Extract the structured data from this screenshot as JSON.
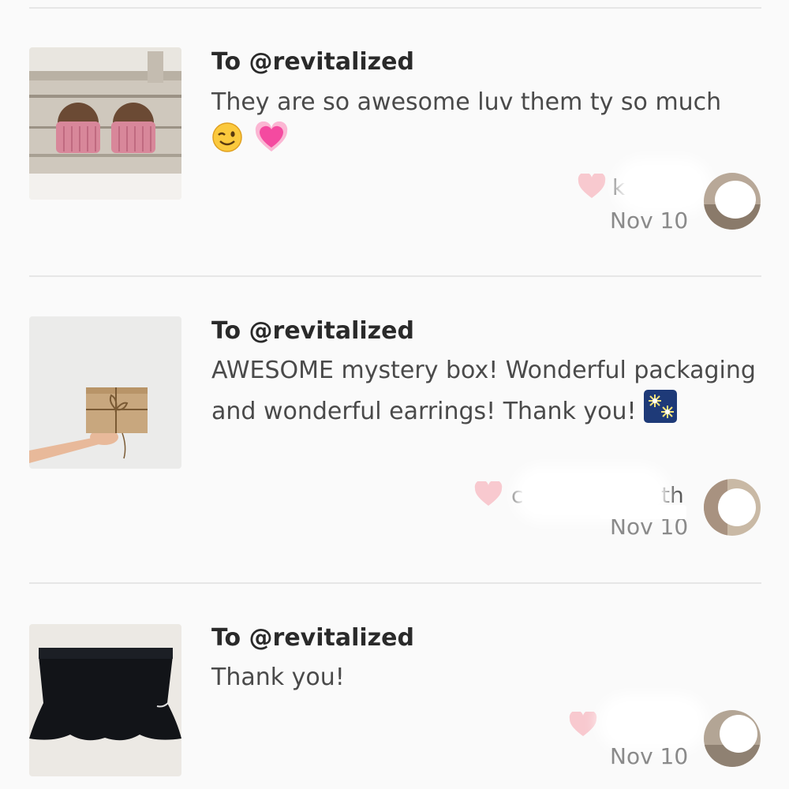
{
  "feedback": [
    {
      "recipient": "To @revitalized",
      "message": "They are so awesome luv them ty so much",
      "emojis": [
        "winking-face-emoji",
        "growing-heart-emoji"
      ],
      "author_visible": "k",
      "date": "Nov 10",
      "thumbnail": "pink-tassel-earrings-photo"
    },
    {
      "recipient": "To @revitalized",
      "message": "AWESOME mystery box! Wonderful packaging and wonderful earrings! Thank you!",
      "emojis": [
        "fireworks-emoji"
      ],
      "author_visible_start": "c",
      "author_visible_end": "th",
      "date": "Nov 10",
      "thumbnail": "hand-holding-wrapped-box-photo"
    },
    {
      "recipient": "To @revitalized",
      "message": "Thank you!",
      "emojis": [],
      "date": "Nov 10",
      "thumbnail": "black-skirt-photo"
    }
  ],
  "colors": {
    "like_heart": "#f8c9cf",
    "background": "#fafafa",
    "divider": "#e6e6e6"
  }
}
